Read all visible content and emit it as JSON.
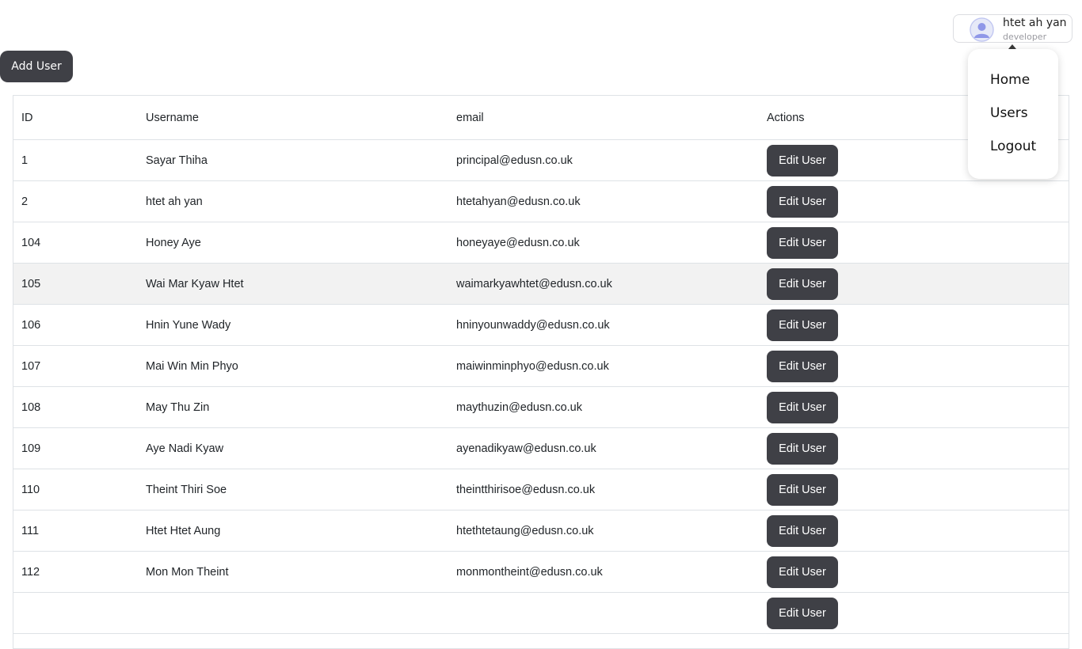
{
  "toolbar": {
    "add_user_label": "Add User"
  },
  "user": {
    "name": "htet ah yan",
    "role": "developer",
    "avatar_icon": "user-avatar-icon"
  },
  "menu": {
    "items": [
      "Home",
      "Users",
      "Logout"
    ]
  },
  "table": {
    "headers": {
      "id": "ID",
      "username": "Username",
      "email": "email",
      "actions": "Actions"
    },
    "edit_label": "Edit User",
    "highlight_row_id": "105",
    "rows": [
      {
        "id": "1",
        "username": "Sayar Thiha",
        "email": "principal@edusn.co.uk"
      },
      {
        "id": "2",
        "username": "htet ah yan",
        "email": "htetahyan@edusn.co.uk"
      },
      {
        "id": "104",
        "username": "Honey Aye",
        "email": "honeyaye@edusn.co.uk"
      },
      {
        "id": "105",
        "username": "Wai Mar Kyaw Htet",
        "email": "waimarkyawhtet@edusn.co.uk"
      },
      {
        "id": "106",
        "username": "Hnin Yune Wady",
        "email": "hninyounwaddy@edusn.co.uk"
      },
      {
        "id": "107",
        "username": "Mai Win Min Phyo",
        "email": "maiwinminphyo@edusn.co.uk"
      },
      {
        "id": "108",
        "username": "May Thu Zin",
        "email": "maythuzin@edusn.co.uk"
      },
      {
        "id": "109",
        "username": "Aye Nadi Kyaw",
        "email": "ayenadikyaw@edusn.co.uk"
      },
      {
        "id": "110",
        "username": "Theint Thiri Soe",
        "email": "theintthirisoe@edusn.co.uk"
      },
      {
        "id": "111",
        "username": "Htet Htet Aung",
        "email": "htethtetaung@edusn.co.uk"
      },
      {
        "id": "112",
        "username": "Mon Mon Theint",
        "email": "monmontheint@edusn.co.uk"
      },
      {
        "id": "",
        "username": "",
        "email": ""
      }
    ]
  }
}
